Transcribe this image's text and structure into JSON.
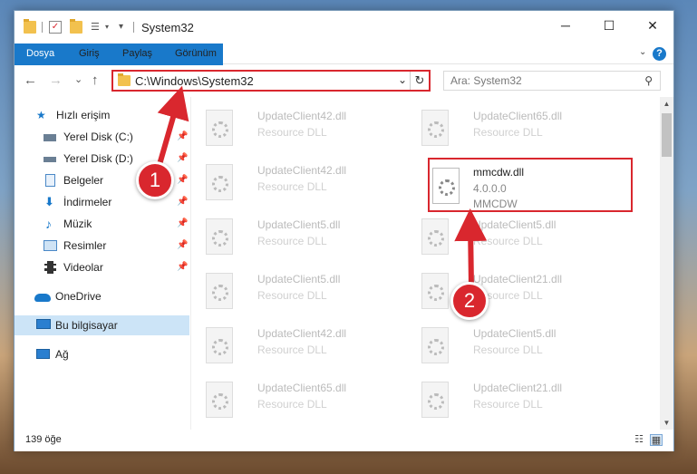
{
  "window": {
    "title": "System32",
    "controls": {
      "minimize": "─",
      "maximize": "☐",
      "close": "✕"
    }
  },
  "ribbon": {
    "tabs": [
      "Dosya",
      "Giriş",
      "Paylaş",
      "Görünüm"
    ],
    "expand_glyph": "⌄",
    "help_glyph": "?"
  },
  "nav": {
    "back": "←",
    "forward": "→",
    "recent": "⌄",
    "up": "↑",
    "address": "C:\\Windows\\System32",
    "address_dropdown": "⌄",
    "refresh": "↻",
    "search_placeholder": "Ara: System32",
    "search_icon": "⚲"
  },
  "sidebar": {
    "items": [
      {
        "label": "Hızlı erişim",
        "icon": "star-icon",
        "color": "#1979ca",
        "pinned": false
      },
      {
        "label": "Yerel Disk (C:)",
        "icon": "drive-icon",
        "color": "#6a7f94",
        "pinned": true
      },
      {
        "label": "Yerel Disk (D:)",
        "icon": "drive-icon",
        "color": "#6a7f94",
        "pinned": true
      },
      {
        "label": "Belgeler",
        "icon": "document-icon",
        "color": "#4a88c7",
        "pinned": true
      },
      {
        "label": "İndirmeler",
        "icon": "download-icon",
        "color": "#1979ca",
        "pinned": true
      },
      {
        "label": "Müzik",
        "icon": "music-icon",
        "color": "#1979ca",
        "pinned": true
      },
      {
        "label": "Resimler",
        "icon": "pictures-icon",
        "color": "#4a88c7",
        "pinned": true
      },
      {
        "label": "Videolar",
        "icon": "video-icon",
        "color": "#333333",
        "pinned": true
      },
      {
        "label": "OneDrive",
        "icon": "cloud-icon",
        "color": "#1979ca",
        "pinned": false
      },
      {
        "label": "Bu bilgisayar",
        "icon": "computer-icon",
        "color": "#2a7fd0",
        "pinned": false,
        "selected": true
      },
      {
        "label": "Ağ",
        "icon": "network-icon",
        "color": "#2a7fd0",
        "pinned": false
      }
    ],
    "pin_glyph": "📌"
  },
  "files": [
    {
      "name": "UpdateClient42.dll",
      "desc": "Resource DLL"
    },
    {
      "name": "UpdateClient65.dll",
      "desc": "Resource DLL"
    },
    {
      "name": "UpdateClient42.dll",
      "desc": "Resource DLL"
    },
    {
      "name": "mmcdw.dll",
      "desc": "4.0.0.0",
      "desc2": "MMCDW",
      "highlighted": true
    },
    {
      "name": "UpdateClient5.dll",
      "desc": "Resource DLL"
    },
    {
      "name": "UpdateClient5.dll",
      "desc": "Resource DLL"
    },
    {
      "name": "UpdateClient5.dll",
      "desc": "Resource DLL"
    },
    {
      "name": "UpdateClient21.dll",
      "desc": "Resource DLL"
    },
    {
      "name": "UpdateClient42.dll",
      "desc": "Resource DLL"
    },
    {
      "name": "UpdateClient5.dll",
      "desc": "Resource DLL"
    },
    {
      "name": "UpdateClient65.dll",
      "desc": "Resource DLL"
    },
    {
      "name": "UpdateClient21.dll",
      "desc": "Resource DLL"
    }
  ],
  "status": {
    "count": "139 öğe"
  },
  "callouts": {
    "one": "1",
    "two": "2",
    "color": "#d9272e"
  },
  "colors": {
    "accent": "#1979ca",
    "highlight": "#d9272e",
    "selected_bg": "#cce4f7"
  }
}
